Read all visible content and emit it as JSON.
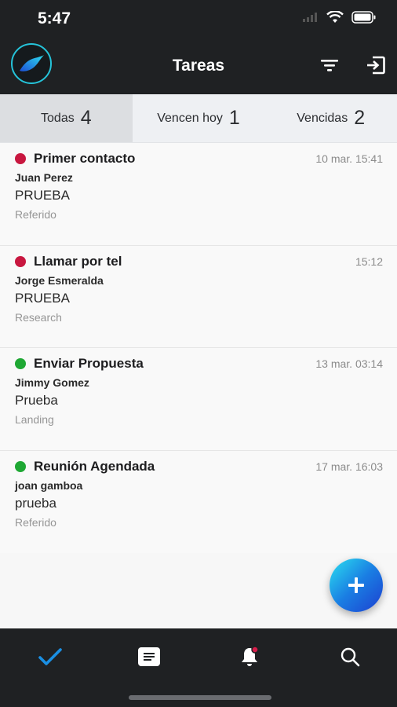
{
  "status_bar": {
    "time": "5:47"
  },
  "header": {
    "title": "Tareas"
  },
  "tabs": [
    {
      "label": "Todas",
      "count": "4"
    },
    {
      "label": "Vencen hoy",
      "count": "1"
    },
    {
      "label": "Vencidas",
      "count": "2"
    }
  ],
  "tasks": [
    {
      "title": "Primer contacto",
      "time": "10 mar. 15:41",
      "contact": "Juan Perez",
      "description": "PRUEBA",
      "source": "Referido",
      "status_color": "#c8173f"
    },
    {
      "title": "Llamar por tel",
      "time": "15:12",
      "contact": "Jorge Esmeralda",
      "description": "PRUEBA",
      "source": "Research",
      "status_color": "#c8173f"
    },
    {
      "title": "Enviar Propuesta",
      "time": "13 mar. 03:14",
      "contact": "Jimmy Gomez",
      "description": "Prueba",
      "source": "Landing",
      "status_color": "#1fa834"
    },
    {
      "title": "Reunión Agendada",
      "time": "17 mar. 16:03",
      "contact": "joan gamboa",
      "description": "prueba",
      "source": "Referido",
      "status_color": "#1fa834"
    }
  ],
  "bottom_nav": [
    {
      "icon": "check-icon",
      "active": true
    },
    {
      "icon": "notes-icon",
      "active": false
    },
    {
      "icon": "bell-icon",
      "active": false
    },
    {
      "icon": "search-icon",
      "active": false
    }
  ],
  "colors": {
    "bar_background": "#1f2123",
    "accent": "#1a8fe3",
    "overdue": "#c8173f",
    "on_time": "#1fa834"
  }
}
